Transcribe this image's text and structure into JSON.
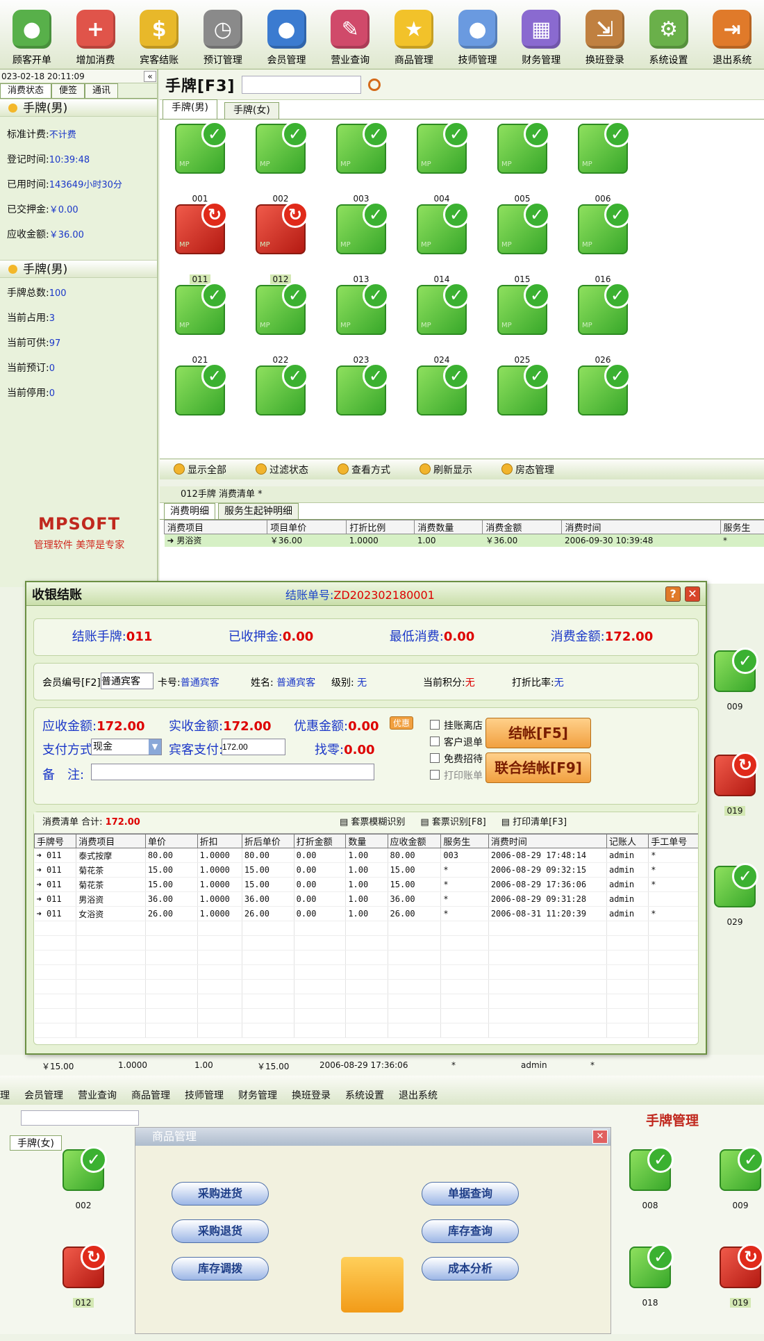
{
  "toolbar": [
    "顾客开单",
    "增加消费",
    "宾客结账",
    "预订管理",
    "会员管理",
    "营业查询",
    "商品管理",
    "技师管理",
    "财务管理",
    "换班登录",
    "系统设置",
    "退出系统"
  ],
  "left": {
    "datetime": "023-02-18 20:11:09",
    "tabs": [
      "消费状态",
      "便签",
      "通讯"
    ],
    "sec1": "手牌(男)",
    "rows1": [
      [
        "标准计费:",
        "不计费"
      ],
      [
        "登记时间:",
        "10:39:48"
      ],
      [
        "已用时间:",
        "143649小时30分"
      ],
      [
        "已交押金:",
        "￥0.00"
      ],
      [
        "应收金额:",
        "￥36.00"
      ]
    ],
    "sec2": "手牌(男)",
    "rows2": [
      [
        "手牌总数:",
        "100"
      ],
      [
        "当前占用:",
        "3"
      ],
      [
        "当前可供:",
        "97"
      ],
      [
        "当前预订:",
        "0"
      ],
      [
        "当前停用:",
        "0"
      ]
    ],
    "logo": "MPSOFT",
    "slogan": "管理软件 美萍是专家"
  },
  "main": {
    "title": "手牌[F3]",
    "tabs": [
      "手牌(男)",
      "手牌(女)"
    ],
    "cards": [
      {
        "no": "001",
        "s": "ok"
      },
      {
        "no": "002",
        "s": "ok"
      },
      {
        "no": "003",
        "s": "ok"
      },
      {
        "no": "004",
        "s": "ok"
      },
      {
        "no": "005",
        "s": "ok"
      },
      {
        "no": "006",
        "s": "ok"
      },
      {
        "no": "011",
        "s": "busy"
      },
      {
        "no": "012",
        "s": "busy"
      },
      {
        "no": "013",
        "s": "ok"
      },
      {
        "no": "014",
        "s": "ok"
      },
      {
        "no": "015",
        "s": "ok"
      },
      {
        "no": "016",
        "s": "ok"
      },
      {
        "no": "021",
        "s": "ok"
      },
      {
        "no": "022",
        "s": "ok"
      },
      {
        "no": "023",
        "s": "ok"
      },
      {
        "no": "024",
        "s": "ok"
      },
      {
        "no": "025",
        "s": "ok"
      },
      {
        "no": "026",
        "s": "ok"
      }
    ],
    "actions": [
      "显示全部",
      "过滤状态",
      "查看方式",
      "刷新显示",
      "房态管理"
    ]
  },
  "sub": {
    "title": "012手牌  消费清单  *",
    "tabs": [
      "消费明细",
      "服务生起钟明细"
    ],
    "headers": [
      "消费项目",
      "项目单价",
      "打折比例",
      "消费数量",
      "消费金额",
      "消费时间",
      "服务生"
    ],
    "row": [
      "男浴资",
      "￥36.00",
      "1.0000",
      "1.00",
      "￥36.00",
      "2006-09-30 10:39:48",
      "*"
    ]
  },
  "dialog": {
    "title": "收银结账",
    "order_label": "结账单号:",
    "order_no": "ZD202302180001",
    "summary": [
      [
        "结账手牌:",
        "011"
      ],
      [
        "已收押金:",
        "0.00"
      ],
      [
        "最低消费:",
        "0.00"
      ],
      [
        "消费金额:",
        "172.00"
      ]
    ],
    "member": {
      "id_label": "会员编号[F2]",
      "id_value": "普通宾客",
      "card_label": "卡号:",
      "card": "普通宾客",
      "name_label": "姓名:",
      "name": "普通宾客",
      "level_label": "级别:",
      "level": "无",
      "points_label": "当前积分:",
      "points": "无",
      "disc_label": "打折比率:",
      "disc": "无"
    },
    "pay": {
      "due_label": "应收金额:",
      "due": "172.00",
      "paid_label": "实收金额:",
      "paid": "172.00",
      "discount_label": "优惠金额:",
      "discount": "0.00",
      "method_label": "支付方式:",
      "method": "现金",
      "guest_label": "宾客支付:",
      "guest": "172.00",
      "change_label": "找零:",
      "change": "0.00",
      "note_label": "备　注:",
      "note": "",
      "youhui": "优惠"
    },
    "options": [
      "挂账离店",
      "客户退单",
      "免费招待",
      "打印账单"
    ],
    "checkout_btn": "结帐[F5]",
    "joint_btn": "联合结帐[F9]",
    "list_title": "消费清单 合计:",
    "list_total": "172.00",
    "list_actions": [
      "套票模糊识别",
      "套票识别[F8]",
      "打印清单[F3]"
    ],
    "headers": [
      "手牌号",
      "消费项目",
      "单价",
      "折扣",
      "折后单价",
      "打折金额",
      "数量",
      "应收金额",
      "服务生",
      "消费时间",
      "记账人",
      "手工单号"
    ],
    "rows": [
      [
        "011",
        "泰式按摩",
        "80.00",
        "1.0000",
        "80.00",
        "0.00",
        "1.00",
        "80.00",
        "003",
        "2006-08-29 17:48:14",
        "admin",
        "*"
      ],
      [
        "011",
        "菊花茶",
        "15.00",
        "1.0000",
        "15.00",
        "0.00",
        "1.00",
        "15.00",
        "*",
        "2006-08-29 09:32:15",
        "admin",
        "*"
      ],
      [
        "011",
        "菊花茶",
        "15.00",
        "1.0000",
        "15.00",
        "0.00",
        "1.00",
        "15.00",
        "*",
        "2006-08-29 17:36:06",
        "admin",
        "*"
      ],
      [
        "011",
        "男浴资",
        "36.00",
        "1.0000",
        "36.00",
        "0.00",
        "1.00",
        "36.00",
        "*",
        "2006-08-29 09:31:28",
        "admin",
        ""
      ],
      [
        "011",
        "女浴资",
        "26.00",
        "1.0000",
        "26.00",
        "0.00",
        "1.00",
        "26.00",
        "*",
        "2006-08-31 11:20:39",
        "admin",
        "*"
      ]
    ]
  },
  "bottom": {
    "strip": [
      "￥15.00",
      "1.0000",
      "1.00",
      "￥15.00",
      "2006-08-29 17:36:06",
      "*",
      "admin",
      "*"
    ],
    "toolbar": [
      "理",
      "会员管理",
      "营业查询",
      "商品管理",
      "技师管理",
      "财务管理",
      "换班登录",
      "系统设置",
      "退出系统"
    ],
    "manage_title": "手牌管理",
    "tab_female": "手牌(女)",
    "goods_title": "商品管理",
    "goods_left": [
      "采购进货",
      "采购退货",
      "库存调拨"
    ],
    "goods_right": [
      "单据查询",
      "库存查询",
      "成本分析"
    ],
    "cards": [
      "002",
      "012",
      "008",
      "009",
      "018",
      "019"
    ],
    "right_cards": [
      "009",
      "019",
      "029"
    ]
  },
  "colors": {
    "accent_green": "#3bb131",
    "busy_red": "#e02a1a",
    "blue_text": "#1b37c8",
    "orange_button": "#f1a040"
  }
}
